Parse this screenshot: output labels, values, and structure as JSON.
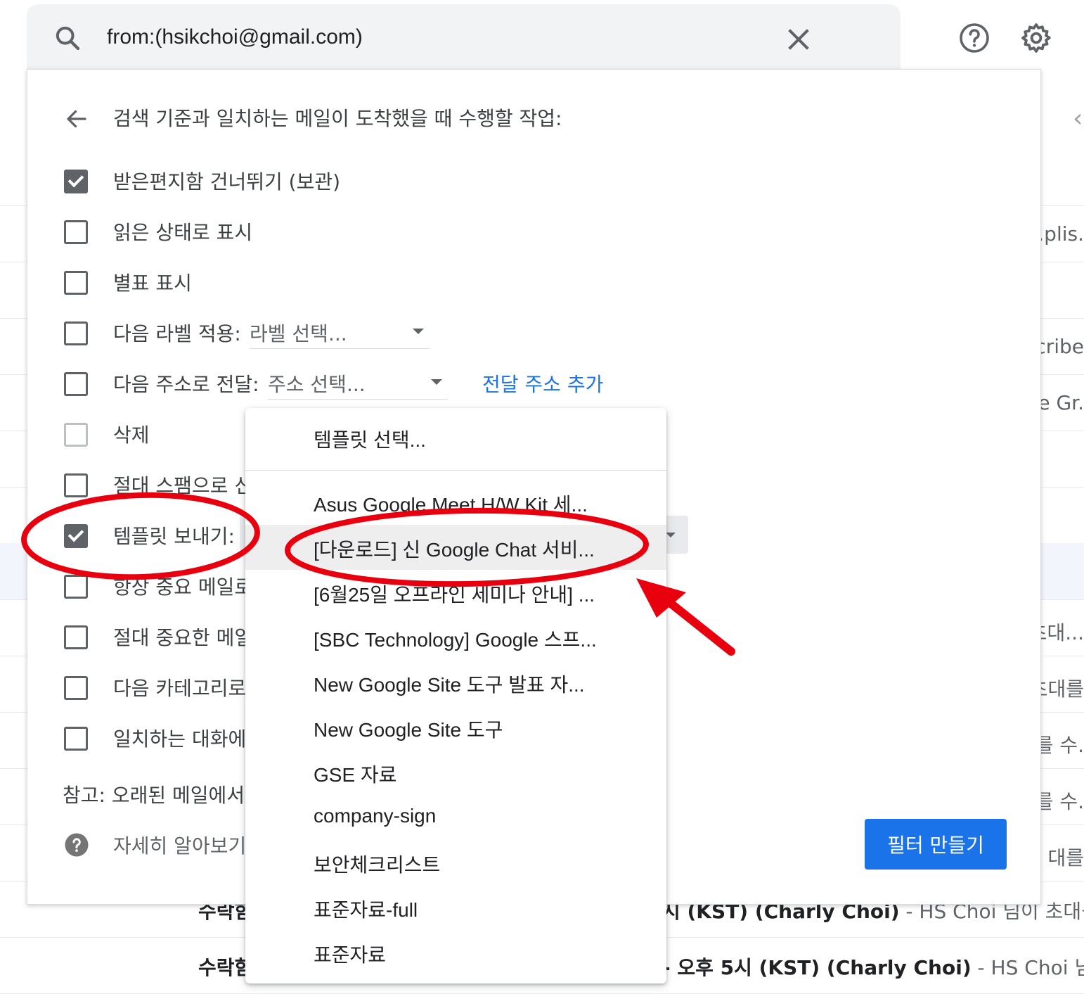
{
  "search": {
    "query": "from:(hsikchoi@gmail.com)"
  },
  "background": {
    "fragments": [
      ".plis.",
      "cribe",
      "e Gr.",
      "초대...",
      "초대를",
      "를 수.",
      "를 수.",
      "대를"
    ],
    "mails": [
      {
        "sender": "수락함",
        "subject_bold": "시 (KST) (Charly Choi)",
        "snippet": " - HS Choi 님이 초대를 수."
      },
      {
        "sender": "수락함",
        "subject_bold": "- 오후 5시 (KST) (Charly Choi)",
        "snippet": " - HS Choi 님이 초"
      }
    ]
  },
  "filter_panel": {
    "title": "검색 기준과 일치하는 메일이 도착했을 때 수행할 작업:",
    "options": [
      {
        "label": "받은편지함 건너뛰기 (보관)",
        "checked": true
      },
      {
        "label": "읽은 상태로 표시",
        "checked": false
      },
      {
        "label": "별표 표시",
        "checked": false
      },
      {
        "label": "다음 라벨 적용:",
        "checked": false,
        "select": "라벨 선택..."
      },
      {
        "label": "다음 주소로 전달:",
        "checked": false,
        "select": "주소 선택...",
        "link": "전달 주소 추가"
      },
      {
        "label": "삭제",
        "checked": false
      },
      {
        "label": "절대 스팸으로 신",
        "checked": false
      },
      {
        "label": "템플릿 보내기:",
        "checked": true
      },
      {
        "label": "항상 중요 메일로",
        "checked": false
      },
      {
        "label": "절대 중요한 메일",
        "checked": false
      },
      {
        "label": "다음 카테고리로",
        "checked": false
      },
      {
        "label": "일치하는 대화에",
        "checked": false
      }
    ],
    "note": "참고: 오래된 메일에서",
    "learn_more": "자세히 알아보기",
    "create_button": "필터 만들기"
  },
  "template_dropdown": {
    "placeholder": "템플릿 선택...",
    "items": [
      "Asus Google Meet H/W Kit 세...",
      "[다운로드] 신 Google Chat 서비...",
      "[6월25일 오프라인 세미나 안내] ...",
      "[SBC Technology] Google 스프...",
      "New Google Site 도구 발표 자...",
      "New Google Site 도구",
      "GSE 자료",
      "company-sign",
      "보안체크리스트",
      "표준자료-full",
      "표준자료"
    ],
    "highlighted_index": 1
  },
  "annotation": {
    "color": "#e8000e"
  }
}
